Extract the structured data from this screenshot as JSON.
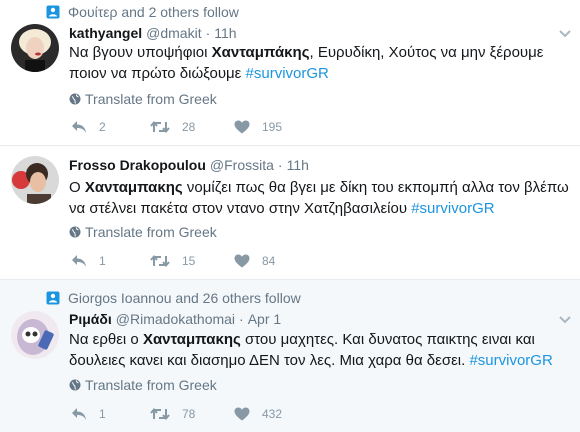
{
  "colors": {
    "text": "#14171a",
    "secondary": "#657786",
    "action": "#8899a6",
    "link": "#1b95e0",
    "highlight_bg": "#f5f8fa",
    "divider": "#e6ecf0"
  },
  "tweets": [
    {
      "context": "Φουίτερ and 2 others follow",
      "name": "kathyangel",
      "handle": "@dmakit",
      "time": "11h",
      "text_1": "Να βγουν υποψήφιοι ",
      "bold_1": "Χανταμπάκης",
      "text_2": ", Ευρυδίκη, Χούτος να μην ξέρουμε ποιον να πρώτο διώξουμε ",
      "hashtag": "#survivorGR",
      "translate": "Translate from Greek",
      "replies": "2",
      "retweets": "28",
      "likes": "195"
    },
    {
      "name": "Frosso Drakopoulou",
      "handle": "@Frossita",
      "time": "11h",
      "text_1": "Ο ",
      "bold_1": "Χανταμπακης",
      "text_2": " νομίζει πως θα βγει με δίκη του εκπομπή αλλα τον βλέπω να στέλνει πακέτα στον ντανο στην Χατζηβασιλείου ",
      "hashtag": "#survivorGR",
      "translate": "Translate from Greek",
      "replies": "1",
      "retweets": "15",
      "likes": "84"
    },
    {
      "context": "Giorgos Ioannou and 26 others follow",
      "name": "Ριμάδι",
      "handle": "@Rimadokathomai",
      "time": "Apr 1",
      "text_1": "Να ερθει ο ",
      "bold_1": "Χανταμπακης",
      "text_2": " στου μαχητες. Και δυνατος παικτης ειναι και δουλειες κανει και διασημο ΔΕΝ τον λες. Μια χαρα θα δεσει. ",
      "hashtag": "#survivorGR",
      "translate": "Translate from Greek",
      "replies": "1",
      "retweets": "78",
      "likes": "432"
    }
  ]
}
